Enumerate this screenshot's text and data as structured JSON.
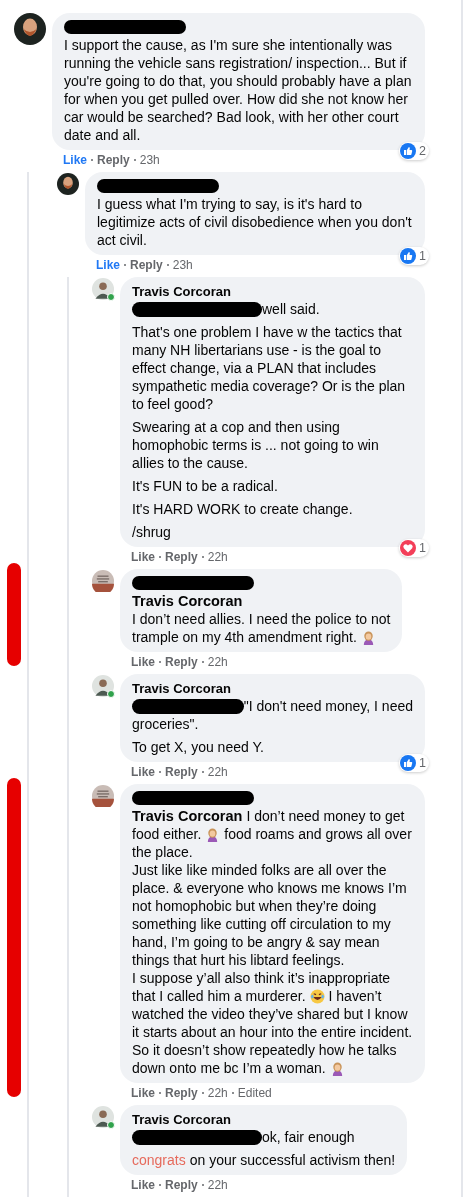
{
  "comments": [
    {
      "avatar": {
        "kind": "bald"
      },
      "online": false,
      "name_redacted": true,
      "paragraphs": [
        [
          [
            {
              "kind": "text",
              "text": "I support the cause, as I'm sure she intentionally was running the vehicle sans registration/ inspection... But if you're going to do that, you should probably have a plan for when you get pulled over. How did she not know her car would be searched? Bad look, with her other court date and all."
            }
          ]
        ]
      ],
      "reaction": {
        "kind": "like",
        "count": "2"
      },
      "like": "Like",
      "reply": "Reply",
      "time": "23h",
      "liked": true,
      "marked": false,
      "children": [
        {
          "avatar": {
            "kind": "bald"
          },
          "online": false,
          "name_redacted": true,
          "paragraphs": [
            [
              [
                {
                  "kind": "text",
                  "text": "I guess what I'm trying to say, is it's hard to legitimize acts of civil disobedience when you don't act civil."
                }
              ]
            ]
          ],
          "reaction": {
            "kind": "like",
            "count": "1"
          },
          "like": "Like",
          "reply": "Reply",
          "time": "23h",
          "liked": true,
          "marked": false,
          "children": [
            {
              "avatar": {
                "kind": "man"
              },
              "online": true,
              "author": "Travis Corcoran",
              "paragraphs": [
                [
                  [
                    {
                      "kind": "redacted"
                    },
                    {
                      "kind": "text",
                      "text": "well said."
                    }
                  ]
                ],
                [
                  [
                    {
                      "kind": "text",
                      "text": "That's one problem I have w the tactics that many NH libertarians use - is the goal to effect change, via a PLAN that includes sympathetic media coverage? Or is the plan to feel good?"
                    }
                  ]
                ],
                [
                  [
                    {
                      "kind": "text",
                      "text": "Swearing at a cop and then using homophobic terms is ... not going to win allies to the cause."
                    }
                  ]
                ],
                [
                  [
                    {
                      "kind": "text",
                      "text": "It's FUN to be a radical."
                    }
                  ]
                ],
                [
                  [
                    {
                      "kind": "text",
                      "text": "It's HARD WORK to create change."
                    }
                  ]
                ],
                [
                  [
                    {
                      "kind": "text",
                      "text": "/shrug"
                    }
                  ]
                ]
              ],
              "reaction": {
                "kind": "heart",
                "count": "1"
              },
              "like": "Like",
              "reply": "Reply",
              "time": "22h",
              "liked": false,
              "marked": false
            },
            {
              "avatar": {
                "kind": "text-image"
              },
              "online": false,
              "name_redacted": true,
              "paragraphs": [
                [
                  [
                    {
                      "kind": "mention",
                      "text": "Travis Corcoran"
                    }
                  ],
                  [
                    {
                      "kind": "text",
                      "text": "I don’t need allies. I need the police to not"
                    }
                  ],
                  [
                    {
                      "kind": "text",
                      "text": "trample on my 4th amendment right."
                    },
                    {
                      "kind": "emoji_person"
                    }
                  ]
                ]
              ],
              "like": "Like",
              "reply": "Reply",
              "time": "22h",
              "liked": false,
              "marked": true
            },
            {
              "avatar": {
                "kind": "man"
              },
              "online": true,
              "author": "Travis Corcoran",
              "paragraphs": [
                [
                  [
                    {
                      "kind": "redacted"
                    },
                    {
                      "kind": "text",
                      "text": "\"I don't need money, I need"
                    }
                  ],
                  [
                    {
                      "kind": "text",
                      "text": "groceries\"."
                    }
                  ]
                ],
                [
                  [
                    {
                      "kind": "text",
                      "text": "To get X, you need Y."
                    }
                  ]
                ]
              ],
              "reaction": {
                "kind": "like",
                "count": "1"
              },
              "like": "Like",
              "reply": "Reply",
              "time": "22h",
              "liked": false,
              "marked": false
            },
            {
              "avatar": {
                "kind": "text-image"
              },
              "online": false,
              "name_redacted": true,
              "paragraphs": [
                [
                  [
                    {
                      "kind": "mention",
                      "text": "Travis Corcoran"
                    },
                    {
                      "kind": "text",
                      "text": "I don’t need money to get"
                    }
                  ],
                  [
                    {
                      "kind": "text",
                      "text": "food either."
                    },
                    {
                      "kind": "emoji_person"
                    },
                    {
                      "kind": "text",
                      "text": "food roams and grows all over"
                    }
                  ],
                  [
                    {
                      "kind": "text",
                      "text": "the place.\nJust like like minded folks are all over the place. & everyone who knows me knows I’m not homophobic but when they’re doing something like cutting off circulation to my hand, I’m going to be angry & say mean things that hurt his libtard feelings.\nI suppose y’all also think it’s inappropriate"
                    }
                  ],
                  [
                    {
                      "kind": "text",
                      "text": "that I called him a murderer."
                    },
                    {
                      "kind": "emoji_laugh"
                    },
                    {
                      "kind": "text",
                      "text": "I haven’t"
                    }
                  ],
                  [
                    {
                      "kind": "text",
                      "text": "watched the video they’ve shared but I know it starts about an hour into the entire incident. So it doesn’t show repeatedly how he talks"
                    }
                  ],
                  [
                    {
                      "kind": "text",
                      "text": "down onto me bc I’m a woman."
                    },
                    {
                      "kind": "emoji_person"
                    }
                  ]
                ]
              ],
              "like": "Like",
              "reply": "Reply",
              "time": "22h",
              "edited": "Edited",
              "liked": false,
              "marked": true
            },
            {
              "avatar": {
                "kind": "man"
              },
              "online": true,
              "author": "Travis Corcoran",
              "paragraphs": [
                [
                  [
                    {
                      "kind": "redacted"
                    },
                    {
                      "kind": "text",
                      "text": "ok, fair enough"
                    }
                  ]
                ],
                [
                  [
                    {
                      "kind": "effect",
                      "text": "congrats"
                    },
                    {
                      "kind": "text",
                      "text": "on your successful activism then!"
                    }
                  ]
                ]
              ],
              "like": "Like",
              "reply": "Reply",
              "time": "22h",
              "liked": false,
              "marked": false
            }
          ]
        }
      ]
    }
  ]
}
